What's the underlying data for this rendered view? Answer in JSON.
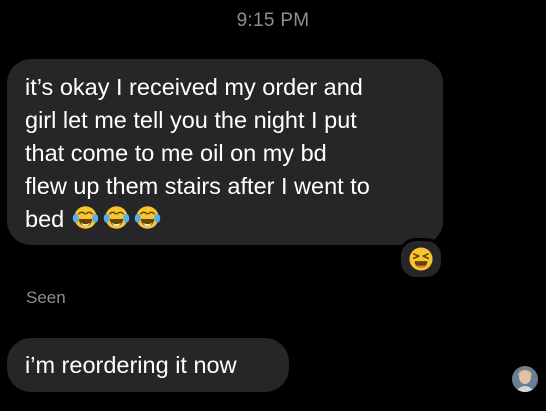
{
  "conversation": {
    "timestamp": "9:15 PM",
    "messages": [
      {
        "lines": [
          "it’s okay I received my order and",
          "girl let me tell you the night I put",
          "that come to me oil on my bd",
          "flew up them stairs after I went to"
        ],
        "last_line": "bed",
        "trailing_emoji": [
          "face-with-tears-of-joy-icon",
          "face-with-tears-of-joy-icon",
          "face-with-tears-of-joy-icon"
        ],
        "reaction": "laughing-face-icon"
      },
      {
        "text": "i’m reordering it now"
      }
    ],
    "read_receipt": "Seen",
    "avatar": "contact-avatar"
  },
  "colors": {
    "background": "#000000",
    "bubble": "#262628",
    "muted_text": "#8e8e93",
    "emoji_yellow": "#f7c531"
  }
}
